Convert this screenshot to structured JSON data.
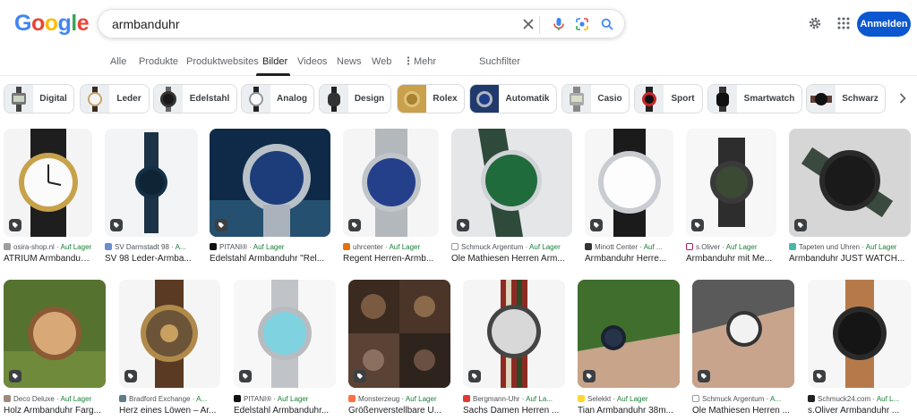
{
  "logo": {
    "letters": [
      "G",
      "o",
      "o",
      "g",
      "l",
      "e"
    ],
    "colors": [
      "#4285f4",
      "#ea4335",
      "#fbbc05",
      "#4285f4",
      "#34a853",
      "#ea4335"
    ]
  },
  "search": {
    "query": "armbanduhr"
  },
  "header": {
    "signin_label": "Anmelden",
    "accent": "#0b57d0"
  },
  "tabs": [
    {
      "label": "Alle"
    },
    {
      "label": "Produkte"
    },
    {
      "label": "Produktwebsites"
    },
    {
      "label": "Bilder",
      "active": true
    },
    {
      "label": "Videos"
    },
    {
      "label": "News"
    },
    {
      "label": "Web"
    },
    {
      "label": "Mehr"
    },
    {
      "label": "Suchfilter"
    }
  ],
  "chips": [
    {
      "label": "Digital"
    },
    {
      "label": "Leder"
    },
    {
      "label": "Edelstahl"
    },
    {
      "label": "Analog"
    },
    {
      "label": "Design"
    },
    {
      "label": "Rolex"
    },
    {
      "label": "Automatik"
    },
    {
      "label": "Casio"
    },
    {
      "label": "Sport"
    },
    {
      "label": "Smartwatch"
    },
    {
      "label": "Schwarz"
    }
  ],
  "results_row1": [
    {
      "source": "osira-shop.nl",
      "stock": "Auf Lager",
      "title": "ATRIUM Armbanduhr ..."
    },
    {
      "source": "SV Darmstadt 98",
      "stock": "A...",
      "title": "SV 98 Leder-Armba..."
    },
    {
      "source": "PITANI®",
      "stock": "Auf Lager",
      "title": "Edelstahl Armbanduhr \"Rel..."
    },
    {
      "source": "uhrcenter",
      "stock": "Auf Lager",
      "title": "Regent Herren-Armb..."
    },
    {
      "source": "Schmuck Argentum",
      "stock": "Auf Lager",
      "title": "Ole Mathiesen Herren Arm..."
    },
    {
      "source": "Minott Center",
      "stock": "Auf ...",
      "title": "Armbanduhr Herre..."
    },
    {
      "source": "s.Oliver",
      "stock": "Auf Lager",
      "title": "Armbanduhr mit Me..."
    },
    {
      "source": "Tapeten und Uhren",
      "stock": "Auf Lager",
      "title": "Armbanduhr JUST WATCH..."
    }
  ],
  "results_row2": [
    {
      "source": "Deco Deluxe",
      "stock": "Auf Lager",
      "title": "Holz Armbanduhr Farg..."
    },
    {
      "source": "Bradford Exchange",
      "stock": "A...",
      "title": "Herz eines Löwen – Ar..."
    },
    {
      "source": "PITANI®",
      "stock": "Auf Lager",
      "title": "Edelstahl Armbanduhr..."
    },
    {
      "source": "Monsterzeug",
      "stock": "Auf Lager",
      "title": "Größenverstellbare U..."
    },
    {
      "source": "Bergmann-Uhr",
      "stock": "Auf La...",
      "title": "Sachs Damen Herren ..."
    },
    {
      "source": "Selekkt",
      "stock": "Auf Lager",
      "title": "Tian Armbanduhr 38m..."
    },
    {
      "source": "Schmuck Argentum",
      "stock": "A...",
      "title": "Ole Mathiesen Herren ..."
    },
    {
      "source": "Schmuck24.com",
      "stock": "Auf L...",
      "title": "s.Oliver Armbanduhr ..."
    }
  ]
}
